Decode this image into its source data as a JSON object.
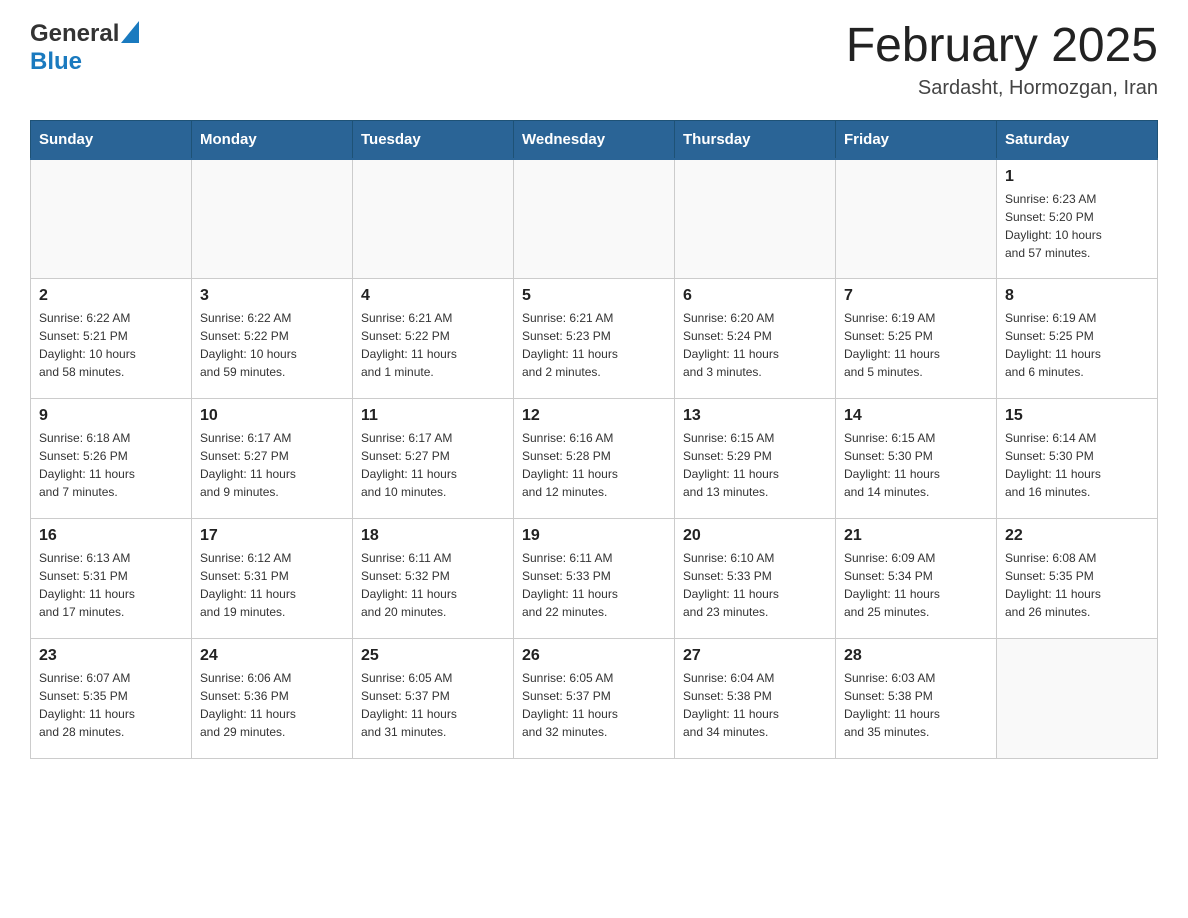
{
  "header": {
    "logo_general": "General",
    "logo_blue": "Blue",
    "month_title": "February 2025",
    "location": "Sardasht, Hormozgan, Iran"
  },
  "calendar": {
    "days_of_week": [
      "Sunday",
      "Monday",
      "Tuesday",
      "Wednesday",
      "Thursday",
      "Friday",
      "Saturday"
    ],
    "weeks": [
      {
        "cells": [
          {
            "day": "",
            "info": ""
          },
          {
            "day": "",
            "info": ""
          },
          {
            "day": "",
            "info": ""
          },
          {
            "day": "",
            "info": ""
          },
          {
            "day": "",
            "info": ""
          },
          {
            "day": "",
            "info": ""
          },
          {
            "day": "1",
            "info": "Sunrise: 6:23 AM\nSunset: 5:20 PM\nDaylight: 10 hours\nand 57 minutes."
          }
        ]
      },
      {
        "cells": [
          {
            "day": "2",
            "info": "Sunrise: 6:22 AM\nSunset: 5:21 PM\nDaylight: 10 hours\nand 58 minutes."
          },
          {
            "day": "3",
            "info": "Sunrise: 6:22 AM\nSunset: 5:22 PM\nDaylight: 10 hours\nand 59 minutes."
          },
          {
            "day": "4",
            "info": "Sunrise: 6:21 AM\nSunset: 5:22 PM\nDaylight: 11 hours\nand 1 minute."
          },
          {
            "day": "5",
            "info": "Sunrise: 6:21 AM\nSunset: 5:23 PM\nDaylight: 11 hours\nand 2 minutes."
          },
          {
            "day": "6",
            "info": "Sunrise: 6:20 AM\nSunset: 5:24 PM\nDaylight: 11 hours\nand 3 minutes."
          },
          {
            "day": "7",
            "info": "Sunrise: 6:19 AM\nSunset: 5:25 PM\nDaylight: 11 hours\nand 5 minutes."
          },
          {
            "day": "8",
            "info": "Sunrise: 6:19 AM\nSunset: 5:25 PM\nDaylight: 11 hours\nand 6 minutes."
          }
        ]
      },
      {
        "cells": [
          {
            "day": "9",
            "info": "Sunrise: 6:18 AM\nSunset: 5:26 PM\nDaylight: 11 hours\nand 7 minutes."
          },
          {
            "day": "10",
            "info": "Sunrise: 6:17 AM\nSunset: 5:27 PM\nDaylight: 11 hours\nand 9 minutes."
          },
          {
            "day": "11",
            "info": "Sunrise: 6:17 AM\nSunset: 5:27 PM\nDaylight: 11 hours\nand 10 minutes."
          },
          {
            "day": "12",
            "info": "Sunrise: 6:16 AM\nSunset: 5:28 PM\nDaylight: 11 hours\nand 12 minutes."
          },
          {
            "day": "13",
            "info": "Sunrise: 6:15 AM\nSunset: 5:29 PM\nDaylight: 11 hours\nand 13 minutes."
          },
          {
            "day": "14",
            "info": "Sunrise: 6:15 AM\nSunset: 5:30 PM\nDaylight: 11 hours\nand 14 minutes."
          },
          {
            "day": "15",
            "info": "Sunrise: 6:14 AM\nSunset: 5:30 PM\nDaylight: 11 hours\nand 16 minutes."
          }
        ]
      },
      {
        "cells": [
          {
            "day": "16",
            "info": "Sunrise: 6:13 AM\nSunset: 5:31 PM\nDaylight: 11 hours\nand 17 minutes."
          },
          {
            "day": "17",
            "info": "Sunrise: 6:12 AM\nSunset: 5:31 PM\nDaylight: 11 hours\nand 19 minutes."
          },
          {
            "day": "18",
            "info": "Sunrise: 6:11 AM\nSunset: 5:32 PM\nDaylight: 11 hours\nand 20 minutes."
          },
          {
            "day": "19",
            "info": "Sunrise: 6:11 AM\nSunset: 5:33 PM\nDaylight: 11 hours\nand 22 minutes."
          },
          {
            "day": "20",
            "info": "Sunrise: 6:10 AM\nSunset: 5:33 PM\nDaylight: 11 hours\nand 23 minutes."
          },
          {
            "day": "21",
            "info": "Sunrise: 6:09 AM\nSunset: 5:34 PM\nDaylight: 11 hours\nand 25 minutes."
          },
          {
            "day": "22",
            "info": "Sunrise: 6:08 AM\nSunset: 5:35 PM\nDaylight: 11 hours\nand 26 minutes."
          }
        ]
      },
      {
        "cells": [
          {
            "day": "23",
            "info": "Sunrise: 6:07 AM\nSunset: 5:35 PM\nDaylight: 11 hours\nand 28 minutes."
          },
          {
            "day": "24",
            "info": "Sunrise: 6:06 AM\nSunset: 5:36 PM\nDaylight: 11 hours\nand 29 minutes."
          },
          {
            "day": "25",
            "info": "Sunrise: 6:05 AM\nSunset: 5:37 PM\nDaylight: 11 hours\nand 31 minutes."
          },
          {
            "day": "26",
            "info": "Sunrise: 6:05 AM\nSunset: 5:37 PM\nDaylight: 11 hours\nand 32 minutes."
          },
          {
            "day": "27",
            "info": "Sunrise: 6:04 AM\nSunset: 5:38 PM\nDaylight: 11 hours\nand 34 minutes."
          },
          {
            "day": "28",
            "info": "Sunrise: 6:03 AM\nSunset: 5:38 PM\nDaylight: 11 hours\nand 35 minutes."
          },
          {
            "day": "",
            "info": ""
          }
        ]
      }
    ]
  }
}
